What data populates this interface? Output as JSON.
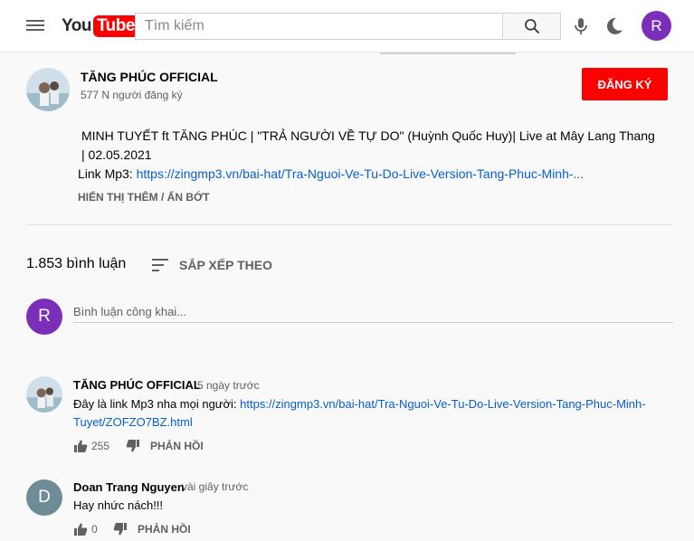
{
  "header": {
    "logo_you": "You",
    "logo_tube": "Tube",
    "search_placeholder": "Tìm kiếm",
    "avatar_letter": "R",
    "brand_red": "#ff0000",
    "avatar_color": "#7b2fb8"
  },
  "channel": {
    "name": "TĂNG PHÚC OFFICIAL",
    "subscribers": "577 N người đăng ký",
    "subscribe_label": "ĐĂNG KÝ"
  },
  "description": {
    "line1": "MINH TUYẾT ft TĂNG PHÚC | \"TRẢ NGƯỜI VỀ TỰ DO\" (Huỳnh Quốc Huy)| Live at Mây Lang Thang | 02.05.2021",
    "link_prefix": "Link Mp3: ",
    "link_text": "https://zingmp3.vn/bai-hat/Tra-Nguoi-Ve-Tu-Do-Live-Version-Tang-Phuc-Minh-...",
    "show_more": "HIỂN THỊ THÊM / ẨN BỚT"
  },
  "comments_section": {
    "count_label": "1.853 bình luận",
    "sort_label": "SẮP XẾP THEO",
    "my_avatar_letter": "R",
    "input_placeholder": "Bình luận công khai..."
  },
  "comments": [
    {
      "author": "TĂNG PHÚC OFFICIAL",
      "time": "5 ngày trước",
      "text_prefix": "Đây là link Mp3 nha mọi người: ",
      "link_line1": "https://zingmp3.vn/bai-hat/Tra-Nguoi-Ve-Tu-Do-Live-Version-Tang-Phuc-Minh-",
      "link_line2": "Tuyet/ZOFZO7BZ.html",
      "likes": "255",
      "reply_label": "PHẢN HỒI"
    },
    {
      "author": "Doan Trang Nguyen",
      "time": "vài giây trước",
      "avatar_letter": "D",
      "text": "Hay nhức nách!!!",
      "likes": "0",
      "reply_label": "PHẢN HỒI"
    }
  ]
}
